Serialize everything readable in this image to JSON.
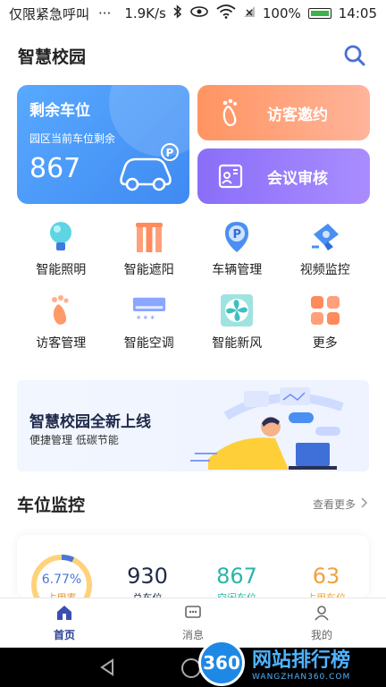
{
  "status_bar": {
    "carrier": "仅限紧急呼叫",
    "dots": "···",
    "speed": "1.9K/s",
    "battery": "100%",
    "time": "14:05"
  },
  "header": {
    "title": "智慧校园"
  },
  "parking_card": {
    "title": "剩余车位",
    "subtitle": "园区当前车位剩余",
    "count": "867"
  },
  "visit_card": {
    "label": "访客邀约"
  },
  "meeting_card": {
    "label": "会议审核"
  },
  "functions": [
    {
      "label": "智能照明",
      "icon": "lightbulb-icon"
    },
    {
      "label": "智能遮阳",
      "icon": "blinds-icon"
    },
    {
      "label": "车辆管理",
      "icon": "parking-pin-icon"
    },
    {
      "label": "视频监控",
      "icon": "camera-icon"
    },
    {
      "label": "访客管理",
      "icon": "footprint-icon"
    },
    {
      "label": "智能空调",
      "icon": "air-conditioner-icon"
    },
    {
      "label": "智能新风",
      "icon": "fan-icon"
    },
    {
      "label": "更多",
      "icon": "grid-more-icon"
    }
  ],
  "banner": {
    "title": "智慧校园全新上线",
    "subtitle": "便捷管理 低碳节能"
  },
  "section": {
    "title": "车位监控",
    "more": "查看更多"
  },
  "stats": {
    "usage_pct": "6.77%",
    "usage_fraction": 0.0677,
    "usage_label": "占用率",
    "total_value": "930",
    "total_label": "总车位",
    "free_value": "867",
    "free_label": "空闲车位",
    "used_value": "63",
    "used_label": "占用车位"
  },
  "tabs": [
    {
      "label": "首页",
      "icon": "home-icon",
      "active": true
    },
    {
      "label": "消息",
      "icon": "message-icon",
      "active": false
    },
    {
      "label": "我的",
      "icon": "profile-icon",
      "active": false
    }
  ],
  "watermark": {
    "logo_text": "360",
    "title": "网站排行榜",
    "url": "WANGZHAN360.COM"
  },
  "colors": {
    "parking_blue": "#4b9af8",
    "visit_orange": "#ff9a6a",
    "meeting_purple": "#8e72f9",
    "total_color": "#1f2a4a",
    "free_color": "#2bb5a8",
    "used_color": "#f2a23a"
  }
}
